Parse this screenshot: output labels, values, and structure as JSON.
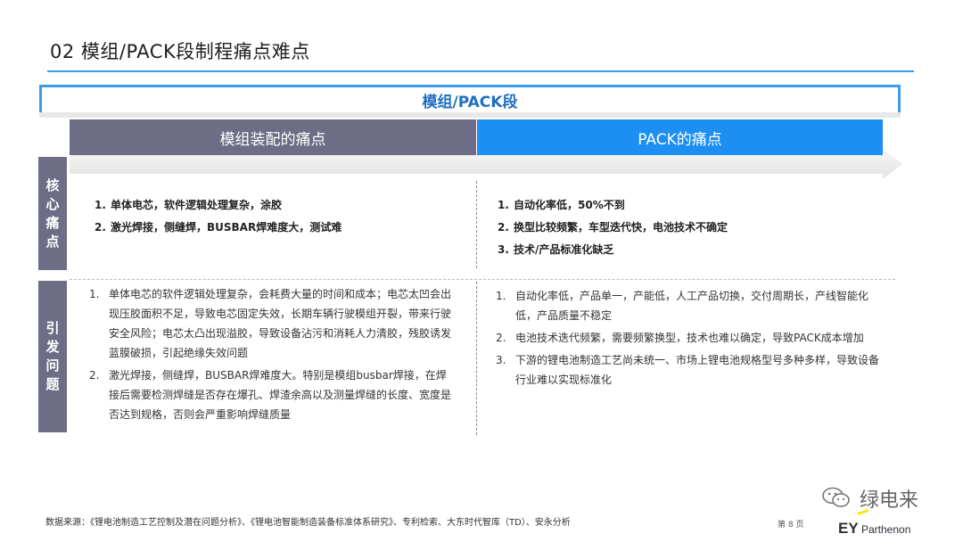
{
  "slide": {
    "title": "02 模组/PACK段制程痛点难点",
    "section": "模组/PACK段",
    "left_header": "模组装配的痛点",
    "right_header": "PACK的痛点",
    "side_core": [
      "核",
      "心",
      "痛",
      "点"
    ],
    "side_cause": [
      "引",
      "发",
      "问",
      "题"
    ]
  },
  "core_left": [
    {
      "num": "1.",
      "text": "单体电芯，软件逻辑处理复杂，涂胶"
    },
    {
      "num": "2.",
      "text": "激光焊接，侧缝焊，BUSBAR焊难度大，测试难"
    }
  ],
  "core_right": [
    {
      "num": "1.",
      "text": "自动化率低，50%不到"
    },
    {
      "num": "2.",
      "text": "换型比较频繁，车型迭代快，电池技术不确定"
    },
    {
      "num": "3.",
      "text": "技术/产品标准化缺乏"
    }
  ],
  "cause_left": [
    {
      "num": "1.",
      "text": "单体电芯的软件逻辑处理复杂，会耗费大量的时间和成本；电芯太凹会出现压胶面积不足，导致电芯固定失效，长期车辆行驶模组开裂，带来行驶安全风险；电芯太凸出现溢胶，导致设备沾污和消耗人力清胶，残胶诱发蓝膜破损，引起绝缘失效问题"
    },
    {
      "num": "2.",
      "text": "激光焊接，侧缝焊，BUSBAR焊难度大。特别是模组busbar焊接，在焊接后需要检测焊缝是否存在爆孔、焊渣余高以及测量焊缝的长度、宽度是否达到规格，否则会严重影响焊缝质量"
    }
  ],
  "cause_right": [
    {
      "num": "1.",
      "text": "自动化率低，产品单一，产能低，人工产品切换，交付周期长，产线智能化低，产品质量不稳定"
    },
    {
      "num": "2.",
      "text": "电池技术迭代频繁，需要频繁换型，技术也难以确定，导致PACK成本增加"
    },
    {
      "num": "3.",
      "text": "下游的锂电池制造工艺尚未统一、市场上锂电池规格型号多种多样，导致设备行业难以实现标准化"
    }
  ],
  "footer": {
    "source": "数据来源：《锂电池制造工艺控制及潜在问题分析》、《锂电池智能制造装备标准体系研究》、专利检索、大东时代智库（TD）、安永分析",
    "page": "第 8 页",
    "logo_main": "EY",
    "logo_sub": "Parthenon",
    "watermark": "绿电来"
  },
  "colors": {
    "accent_blue": "#1d8ff2",
    "header_gray": "#6d6e85",
    "rule_blue": "#3d9be9",
    "ey_yellow": "#ffe600"
  }
}
